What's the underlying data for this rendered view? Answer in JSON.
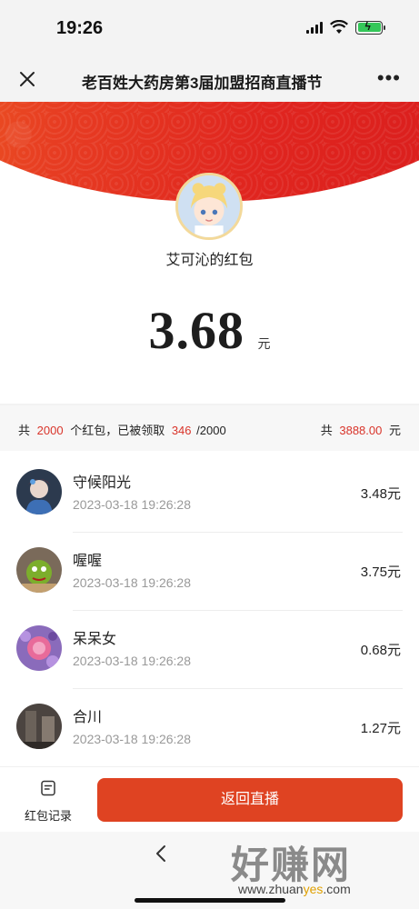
{
  "status": {
    "time": "19:26"
  },
  "nav": {
    "title": "老百姓大药房第3届加盟招商直播节"
  },
  "packet": {
    "sender": "艾可沁的红包",
    "amount": "3.68",
    "unit": "元"
  },
  "summary": {
    "prefix": "共",
    "total_count": "2000",
    "mid1": "个红包，已被领取",
    "claimed": "346",
    "suffix": "/2000",
    "total_prefix": "共",
    "total_amount": "3888.00",
    "total_unit": "元"
  },
  "records": [
    {
      "name": "守候阳光",
      "time": "2023-03-18 19:26:28",
      "amount": "3.48元"
    },
    {
      "name": "喔喔",
      "time": "2023-03-18 19:26:28",
      "amount": "3.75元"
    },
    {
      "name": "呆呆女",
      "time": "2023-03-18 19:26:28",
      "amount": "0.68元"
    },
    {
      "name": "合川",
      "time": "2023-03-18 19:26:28",
      "amount": "1.27元"
    }
  ],
  "bottom": {
    "record_label": "红包记录",
    "back_live_label": "返回直播"
  },
  "watermark": {
    "title": "好赚网",
    "url_pre": "www.zhuan",
    "url_mid": "yes",
    "url_post": ".com"
  },
  "colors": {
    "accent_red": "#df4322",
    "highlight_red": "#d9342a",
    "banner_red": "#e0251f"
  }
}
